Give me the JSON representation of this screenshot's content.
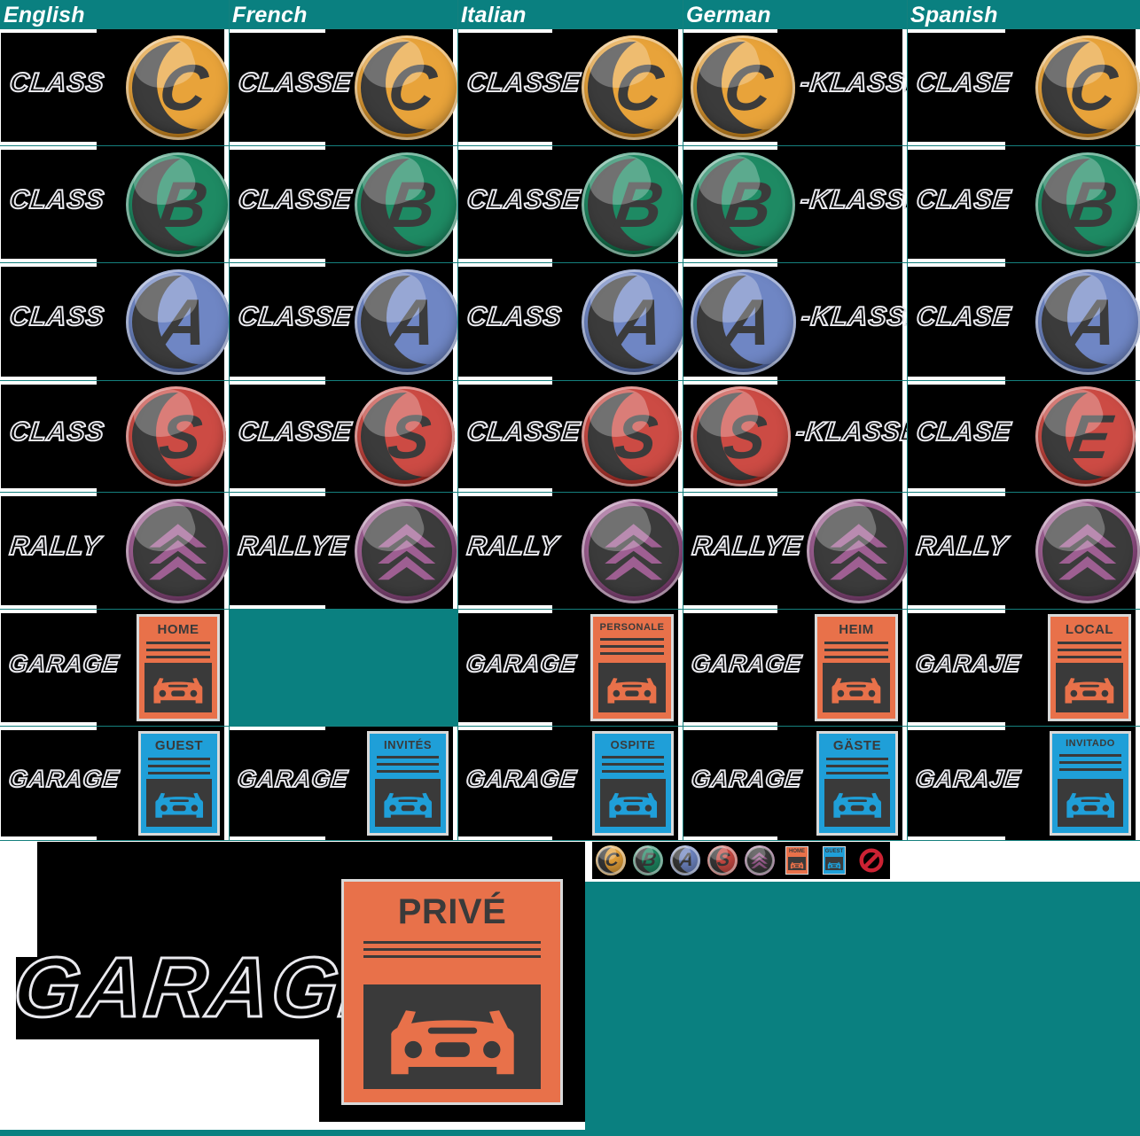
{
  "colors": {
    "teal": "#0a8080",
    "gridline": "#15807e",
    "black": "#000000",
    "class_c": "#e8a33a",
    "class_b": "#1e8a63",
    "class_a": "#6f86c4",
    "class_s": "#cc4b44",
    "class_e": "#cc4b44",
    "rally": "#9e5f92",
    "badge_dark": "#3b3b3b",
    "poster_home": "#e8714a",
    "poster_guest": "#1f9fd8",
    "poster_frame": "#d9d9d9",
    "poster_ink": "#3a3a3a",
    "forbidden_red": "#cc2233"
  },
  "header": {
    "columns": [
      {
        "label": "English"
      },
      {
        "label": "French"
      },
      {
        "label": "Italian"
      },
      {
        "label": "German"
      },
      {
        "label": "Spanish"
      }
    ]
  },
  "rows": [
    {
      "id": "class-c",
      "badge": {
        "letter": "C",
        "color_key": "class_c",
        "name": "class-c-emblem"
      },
      "cells": [
        {
          "lang": "english",
          "text": "CLASS",
          "text_side": "left"
        },
        {
          "lang": "french",
          "text": "CLASSE",
          "text_side": "left"
        },
        {
          "lang": "italian",
          "text": "CLASSE",
          "text_side": "left"
        },
        {
          "lang": "german",
          "text": "-KLASSE",
          "text_side": "right"
        },
        {
          "lang": "spanish",
          "text": "CLASE",
          "text_side": "left"
        }
      ]
    },
    {
      "id": "class-b",
      "badge": {
        "letter": "B",
        "color_key": "class_b",
        "name": "class-b-emblem"
      },
      "cells": [
        {
          "lang": "english",
          "text": "CLASS",
          "text_side": "left"
        },
        {
          "lang": "french",
          "text": "CLASSE",
          "text_side": "left"
        },
        {
          "lang": "italian",
          "text": "CLASSE",
          "text_side": "left"
        },
        {
          "lang": "german",
          "text": "-KLASSE",
          "text_side": "right"
        },
        {
          "lang": "spanish",
          "text": "CLASE",
          "text_side": "left"
        }
      ]
    },
    {
      "id": "class-a",
      "badge": {
        "letter": "A",
        "color_key": "class_a",
        "name": "class-a-emblem"
      },
      "cells": [
        {
          "lang": "english",
          "text": "CLASS",
          "text_side": "left"
        },
        {
          "lang": "french",
          "text": "CLASSE",
          "text_side": "left"
        },
        {
          "lang": "italian",
          "text": "CLASS",
          "text_side": "left"
        },
        {
          "lang": "german",
          "text": "-KLASSE",
          "text_side": "right"
        },
        {
          "lang": "spanish",
          "text": "CLASE",
          "text_side": "left"
        }
      ]
    },
    {
      "id": "class-s",
      "badge": {
        "letter": "S",
        "color_key": "class_s",
        "name": "class-s-emblem"
      },
      "cells": [
        {
          "lang": "english",
          "text": "CLASS",
          "text_side": "left"
        },
        {
          "lang": "french",
          "text": "CLASSE",
          "text_side": "left"
        },
        {
          "lang": "italian",
          "text": "CLASSE",
          "text_side": "left"
        },
        {
          "lang": "german",
          "text": "-KLASSE",
          "text_side": "right"
        },
        {
          "lang": "spanish",
          "text": "CLASE",
          "text_side": "left",
          "badge_letter": "E"
        }
      ]
    },
    {
      "id": "rally",
      "badge": {
        "letter": "",
        "color_key": "rally",
        "name": "rally-emblem"
      },
      "cells": [
        {
          "lang": "english",
          "text": "RALLY",
          "text_side": "left"
        },
        {
          "lang": "french",
          "text": "RALLYE",
          "text_side": "left"
        },
        {
          "lang": "italian",
          "text": "RALLY",
          "text_side": "left"
        },
        {
          "lang": "german",
          "text": "RALLYE",
          "text_side": "left"
        },
        {
          "lang": "spanish",
          "text": "RALLY",
          "text_side": "left"
        }
      ]
    },
    {
      "id": "garage-home",
      "poster": {
        "variant": "home",
        "name": "home-garage-poster"
      },
      "cells": [
        {
          "lang": "english",
          "text": "GARAGE",
          "poster_title": "HOME"
        },
        {
          "lang": "french",
          "text": "",
          "poster_title": ""
        },
        {
          "lang": "italian",
          "text": "GARAGE",
          "poster_title": "PERSONALE"
        },
        {
          "lang": "german",
          "text": "GARAGE",
          "poster_title": "HEIM"
        },
        {
          "lang": "spanish",
          "text": "GARAJE",
          "poster_title": "LOCAL"
        }
      ]
    },
    {
      "id": "garage-guest",
      "poster": {
        "variant": "guest",
        "name": "guest-garage-poster"
      },
      "cells": [
        {
          "lang": "english",
          "text": "GARAGE",
          "poster_title": "GUEST"
        },
        {
          "lang": "french",
          "text": "GARAGE",
          "poster_title": "INVITÉS"
        },
        {
          "lang": "italian",
          "text": "GARAGE",
          "poster_title": "OSPITE"
        },
        {
          "lang": "german",
          "text": "GARAGE",
          "poster_title": "GÄSTE"
        },
        {
          "lang": "spanish",
          "text": "GARAJE",
          "poster_title": "INVITADO"
        }
      ]
    }
  ],
  "feature": {
    "word": "GARAGE",
    "poster_title": "PRIVÉ",
    "poster_variant": "home"
  },
  "icon_strip": {
    "items": [
      {
        "name": "mini-class-c-icon",
        "glyph": "C",
        "color_key": "class_c"
      },
      {
        "name": "mini-class-b-icon",
        "glyph": "B",
        "color_key": "class_b"
      },
      {
        "name": "mini-class-a-icon",
        "glyph": "A",
        "color_key": "class_a"
      },
      {
        "name": "mini-class-s-icon",
        "glyph": "S",
        "color_key": "class_s"
      },
      {
        "name": "mini-rally-icon",
        "glyph": "",
        "color_key": "rally"
      },
      {
        "name": "mini-home-garage-icon",
        "glyph": "HOME",
        "color_key": "poster_home"
      },
      {
        "name": "mini-guest-garage-icon",
        "glyph": "GUEST",
        "color_key": "poster_guest"
      },
      {
        "name": "mini-forbidden-icon",
        "glyph": "",
        "color_key": "forbidden_red"
      }
    ]
  }
}
